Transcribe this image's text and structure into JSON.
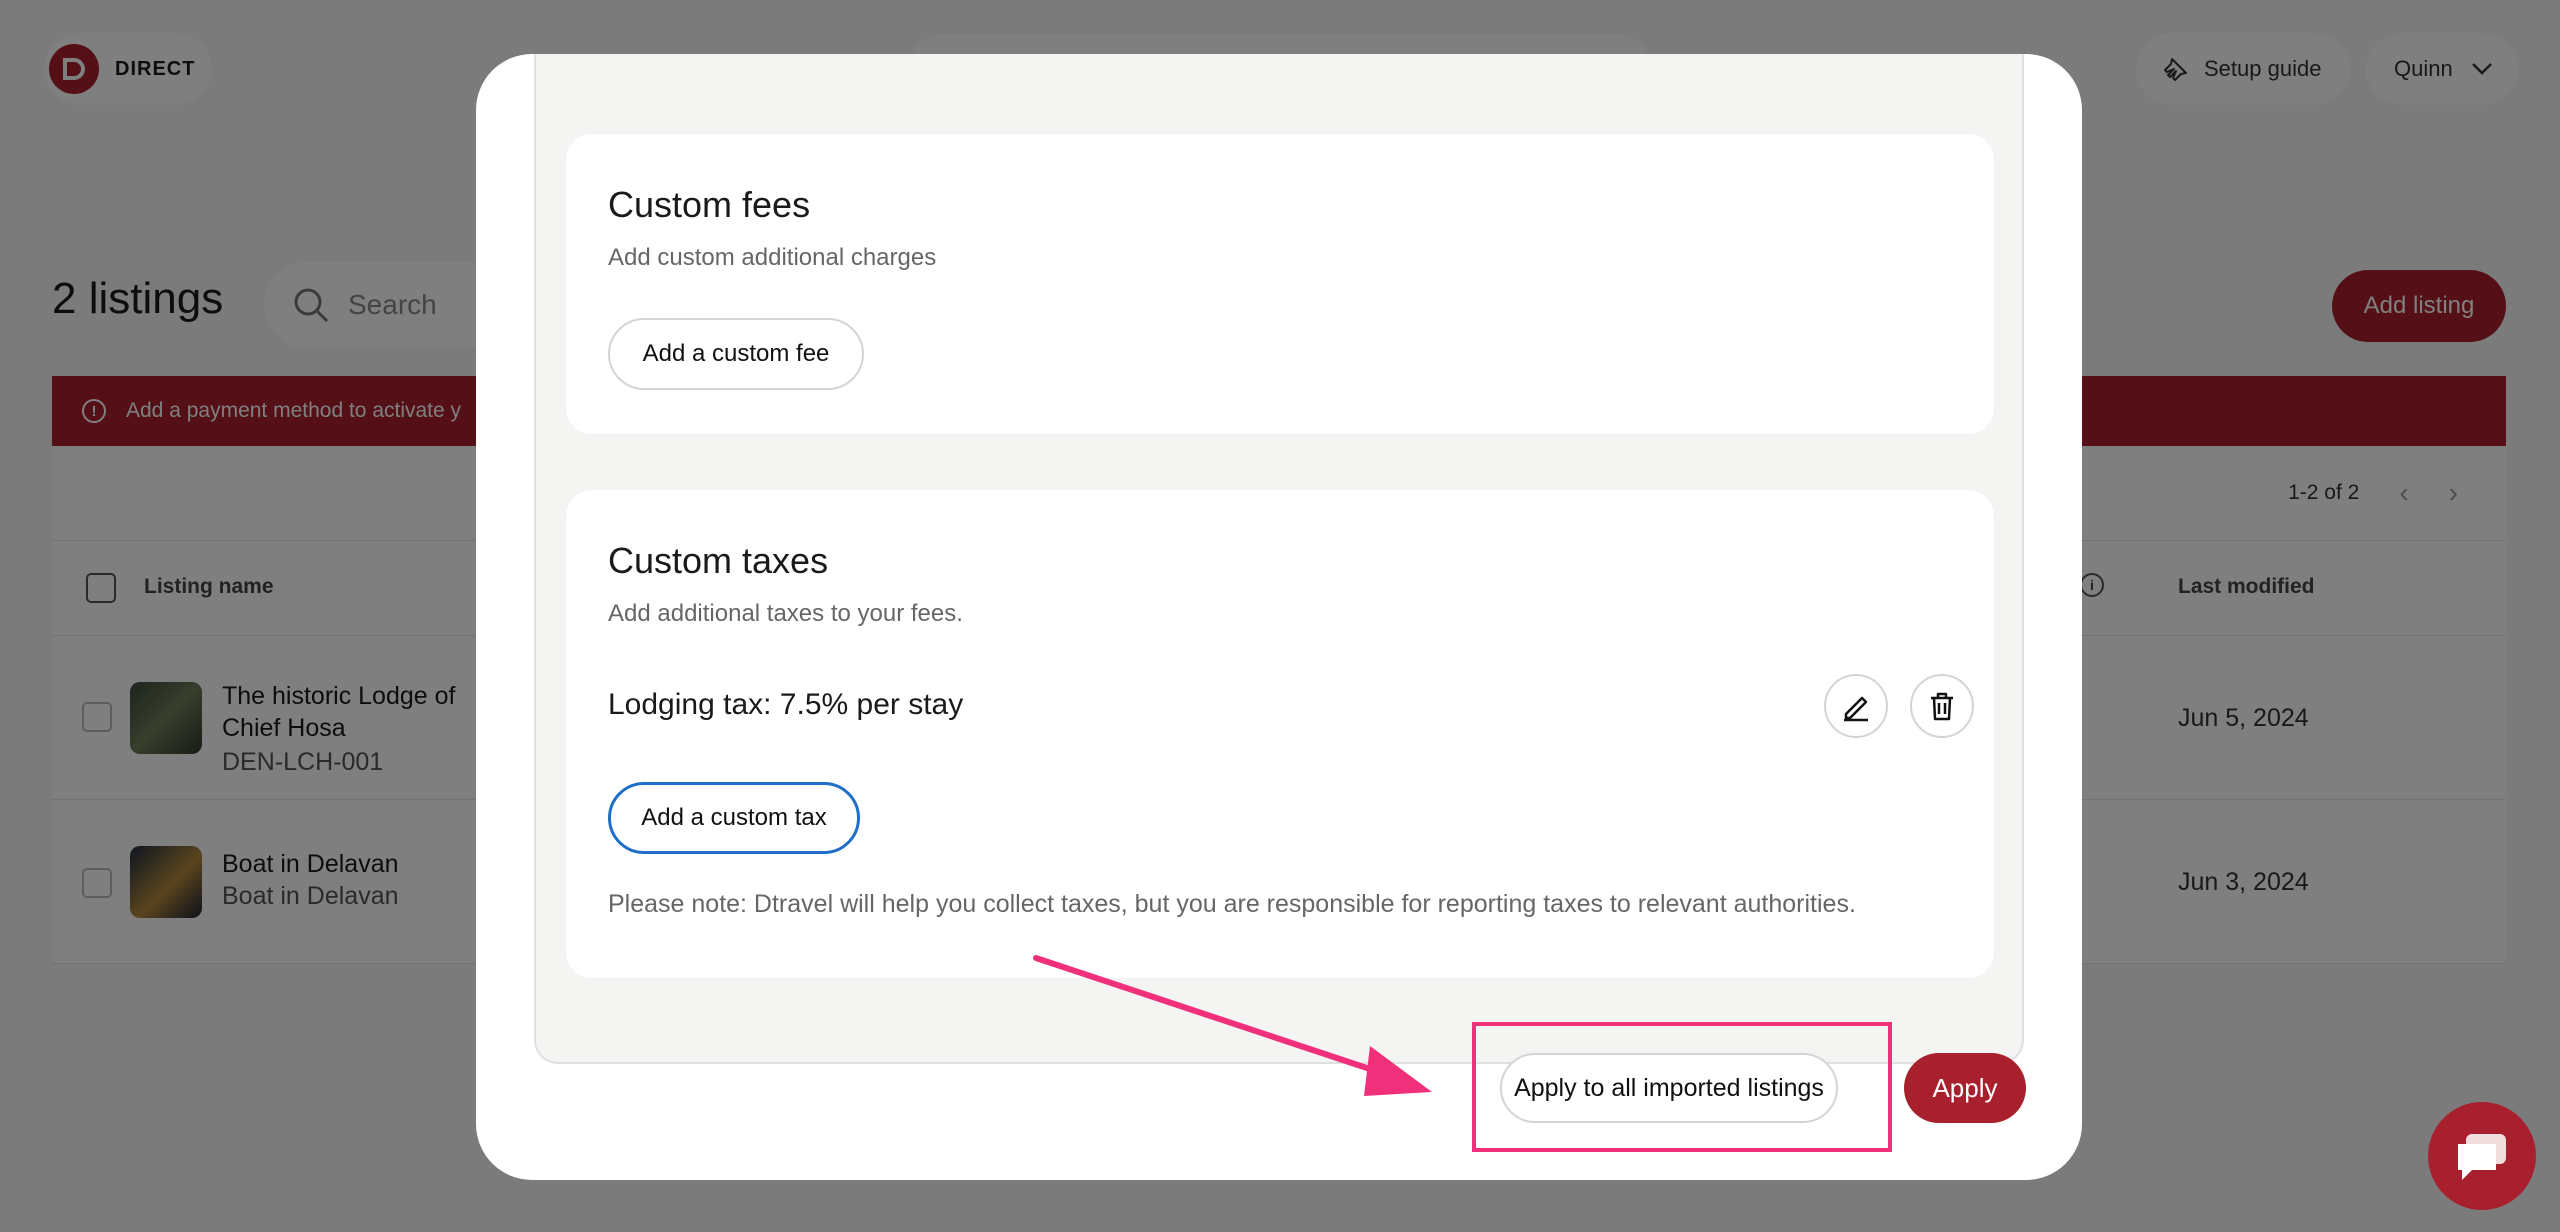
{
  "brand": {
    "name": "DIRECT"
  },
  "topbar": {
    "setup_guide": "Setup guide",
    "user": "Quinn"
  },
  "listings": {
    "title": "2 listings",
    "search_placeholder": "Search",
    "add_button": "Add listing",
    "alert": "Add a payment method to activate y",
    "pagination": "1-2 of 2",
    "columns": {
      "name": "Listing name",
      "last_modified": "Last modified"
    },
    "rows": [
      {
        "name": "The historic Lodge of Chief Hosa",
        "name_line1": "The historic Lodge of",
        "name_line2": "Chief Hosa",
        "code": "DEN-LCH-001",
        "last_modified": "Jun 5, 2024"
      },
      {
        "name": "Boat in Delavan",
        "code": "Boat in Delavan",
        "last_modified": "Jun 3, 2024"
      }
    ]
  },
  "modal": {
    "custom_fees": {
      "title": "Custom fees",
      "description": "Add custom additional charges",
      "add_button": "Add a custom fee"
    },
    "custom_taxes": {
      "title": "Custom taxes",
      "description": "Add additional taxes to your fees.",
      "tax_items": [
        {
          "label": "Lodging tax: 7.5% per stay"
        }
      ],
      "add_button": "Add a custom tax",
      "note": "Please note: Dtravel will help you collect taxes, but you are responsible for reporting taxes to relevant authorities."
    },
    "apply_all_button": "Apply to all imported listings",
    "apply_button": "Apply"
  },
  "colors": {
    "brand": "#a8202d",
    "annotation": "#f0307a",
    "focus": "#1f6fc9"
  }
}
